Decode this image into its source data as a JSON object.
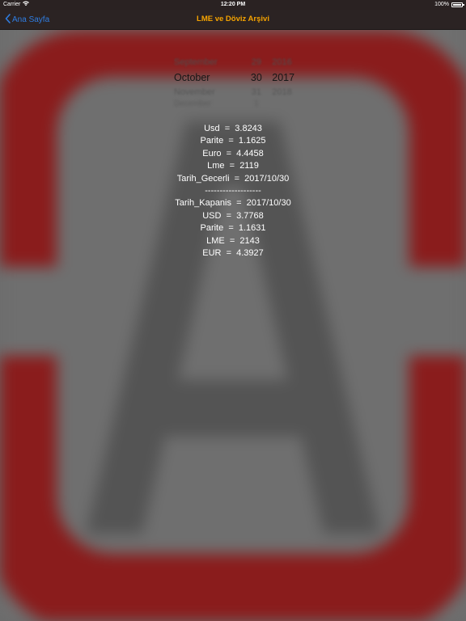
{
  "status_bar": {
    "carrier": "Carrier",
    "time": "12:20 PM",
    "battery": "100%",
    "battery_level": 1.0
  },
  "nav": {
    "back_label": "Ana Sayfa",
    "title": "LME ve Döviz Arşivi"
  },
  "colors": {
    "nav_title": "#f5a300",
    "back": "#2f7de1",
    "logo_red": "#8a1c1c"
  },
  "date_picker": {
    "prev": {
      "month": "September",
      "day": "29",
      "year": "2016"
    },
    "selected": {
      "month": "October",
      "day": "30",
      "year": "2017"
    },
    "next": {
      "month": "November",
      "day": "31",
      "year": "2018"
    },
    "next2": {
      "month": "December",
      "day": "1",
      "year": ""
    }
  },
  "rates": {
    "usd": "Usd  =  3.8243",
    "parite": "Parite  =  1.1625",
    "euro": "Euro  =  4.4458",
    "lme": "Lme  =  2119",
    "tarih_gecerli": "Tarih_Gecerli  =  2017/10/30",
    "separator": "-------------------",
    "tarih_kapanis": "Tarih_Kapanis  =  2017/10/30",
    "usd_close": "USD  =  3.7768",
    "parite_close": "Parite  =  1.1631",
    "lme_close": "LME  =  2143",
    "eur_close": "EUR  =  4.3927"
  },
  "icons": {
    "back": "chevron-left-icon",
    "wifi": "wifi-icon",
    "battery": "battery-icon",
    "logo": "app-logo-a"
  }
}
